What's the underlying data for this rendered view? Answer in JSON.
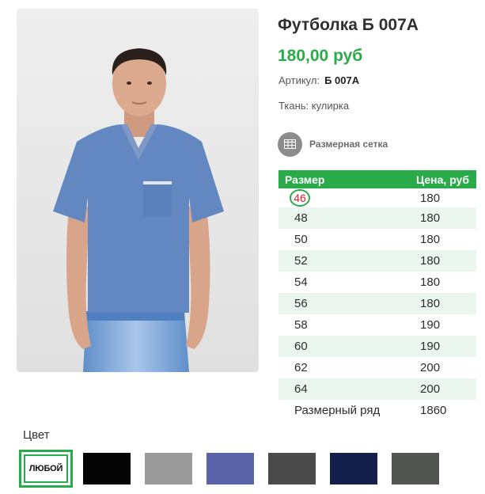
{
  "product": {
    "title": "Футболка Б 007А",
    "price": "180,00 руб",
    "sku_label": "Артикул:",
    "sku_value": "Б 007А",
    "fabric": "Ткань: кулирка",
    "size_chart_label": "Размерная сетка",
    "size_chart_icon": "table-grid-icon"
  },
  "size_table": {
    "headers": {
      "size": "Размер",
      "price": "Цена, руб"
    },
    "rows": [
      {
        "size": "46",
        "price": "180"
      },
      {
        "size": "48",
        "price": "180"
      },
      {
        "size": "50",
        "price": "180"
      },
      {
        "size": "52",
        "price": "180"
      },
      {
        "size": "54",
        "price": "180"
      },
      {
        "size": "56",
        "price": "180"
      },
      {
        "size": "58",
        "price": "190"
      },
      {
        "size": "60",
        "price": "190"
      },
      {
        "size": "62",
        "price": "200"
      },
      {
        "size": "64",
        "price": "200"
      },
      {
        "size": "Размерный ряд",
        "price": "1860"
      }
    ],
    "accent_color": "#2aab4a"
  },
  "colors": {
    "label": "Цвет",
    "any_label": "ЛЮБОЙ",
    "swatches": [
      {
        "name": "black",
        "hex": "#050505"
      },
      {
        "name": "gray",
        "hex": "#9b9b9b"
      },
      {
        "name": "blue-melange",
        "hex": "#5b63a8"
      },
      {
        "name": "dark-gray",
        "hex": "#4a4a4a"
      },
      {
        "name": "navy",
        "hex": "#15204a"
      },
      {
        "name": "dark-gray-green",
        "hex": "#50554f"
      }
    ]
  }
}
